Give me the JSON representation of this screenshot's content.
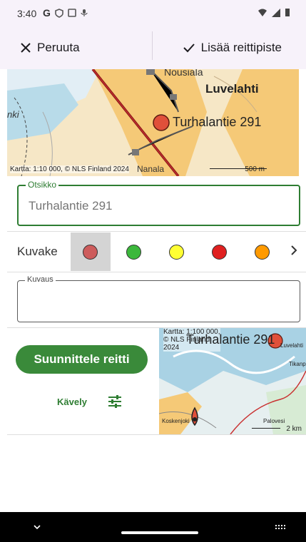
{
  "status": {
    "time": "3:40"
  },
  "toolbar": {
    "cancel_label": "Peruuta",
    "add_label": "Lisää reittipiste"
  },
  "map_top": {
    "places": [
      "Nousiala",
      "Luvelahti",
      "Turhalantie 291",
      "Nanala",
      "nki"
    ],
    "caption": "Kartta: 1:10 000, © NLS Finland 2024",
    "scale": "500 m",
    "marker_color": "#e0503a"
  },
  "title_field": {
    "legend": "Otsikko",
    "placeholder": "Turhalantie 291"
  },
  "icon_picker": {
    "label": "Kuvake",
    "colors": [
      "#cd5c5c",
      "#3cb83c",
      "#ffff33",
      "#e02020",
      "#ff9a00"
    ],
    "selected_index": 0,
    "next_icon": "chevron-right-icon"
  },
  "description_field": {
    "legend": "Kuvaus"
  },
  "route": {
    "plan_label": "Suunnittele reitti",
    "mode_label": "Kävely",
    "settings_icon": "tune-icon"
  },
  "map_small": {
    "caption_line1": "Kartta: 1:100 000,",
    "caption_line2": "© NLS Finland",
    "caption_line3": "2024",
    "title": "Turhalantie 291",
    "places": [
      "Luvelahti",
      "Tikanpää",
      "Koskenjoki",
      "Palovesi"
    ],
    "scale": "2 km"
  },
  "colors": {
    "accent": "#2e7d32",
    "button": "#3a8a3a",
    "topbar": "#f7f2fa"
  }
}
